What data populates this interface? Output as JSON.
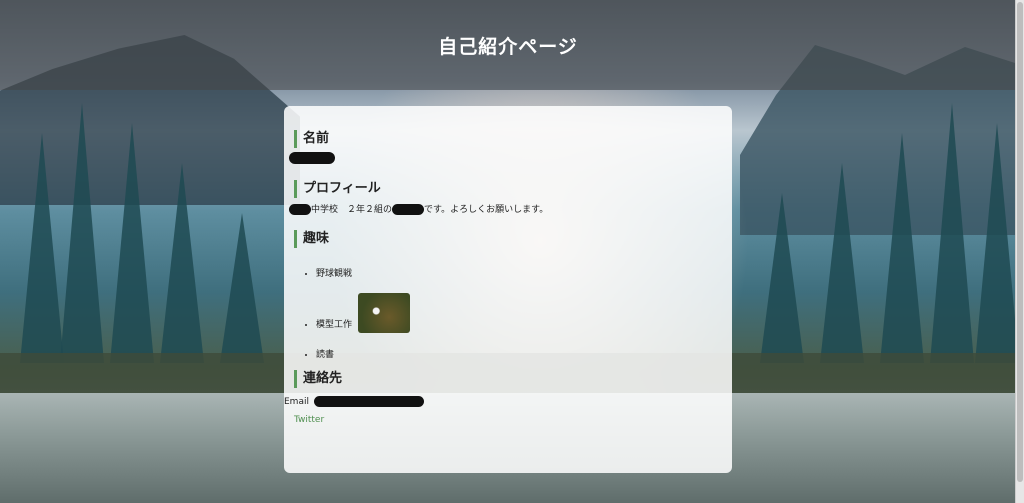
{
  "header": {
    "title": "自己紹介ページ"
  },
  "sections": {
    "name": {
      "heading": "名前"
    },
    "profile": {
      "heading": "プロフィール",
      "text_a": "中学校　２年２組の",
      "text_b": "です。よろしくお願いします。"
    },
    "hobbies": {
      "heading": "趣味",
      "items": [
        "野球観戦",
        "模型工作",
        "読書"
      ]
    },
    "contact": {
      "heading": "連絡先",
      "email_label": "Email",
      "twitter_label": "Twitter"
    }
  },
  "colors": {
    "accent": "#5a9a5a",
    "link": "#4f8f4f"
  }
}
